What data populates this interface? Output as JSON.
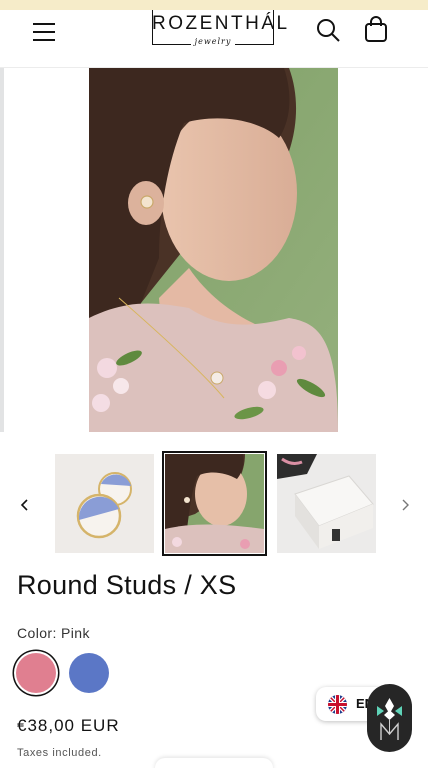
{
  "header": {
    "brand_name": "ROZENTHÁL",
    "brand_sub": "jewelry",
    "menu_icon": "hamburger-menu-icon",
    "search_icon": "search-icon",
    "cart_icon": "cart-icon"
  },
  "gallery": {
    "main_image": "woman-wearing-earring-and-necklace-photo",
    "thumbnails": [
      {
        "image": "round-stud-earrings-pink-white-photo"
      },
      {
        "image": "woman-wearing-earring-photo",
        "active": true
      },
      {
        "image": "gift-box-packaging-photo"
      }
    ],
    "prev_icon": "chevron-left-icon",
    "next_icon": "chevron-right-icon"
  },
  "product": {
    "title": "Round Studs / XS",
    "color_label": "Color: Pink",
    "swatches": [
      {
        "name": "Pink",
        "color": "#e07f90",
        "selected": true
      },
      {
        "name": "Blue",
        "color": "#5b77c6",
        "selected": false
      }
    ],
    "price": "€38,00 EUR",
    "tax_note": "Taxes included."
  },
  "language": {
    "code": "EN",
    "flag_icon": "uk-flag-icon"
  },
  "brand_button": {
    "icon": "brand-logo-icon"
  },
  "colors": {
    "announcement_bar": "#f6ecc9",
    "text": "#121212",
    "brand_button": "#262626"
  }
}
